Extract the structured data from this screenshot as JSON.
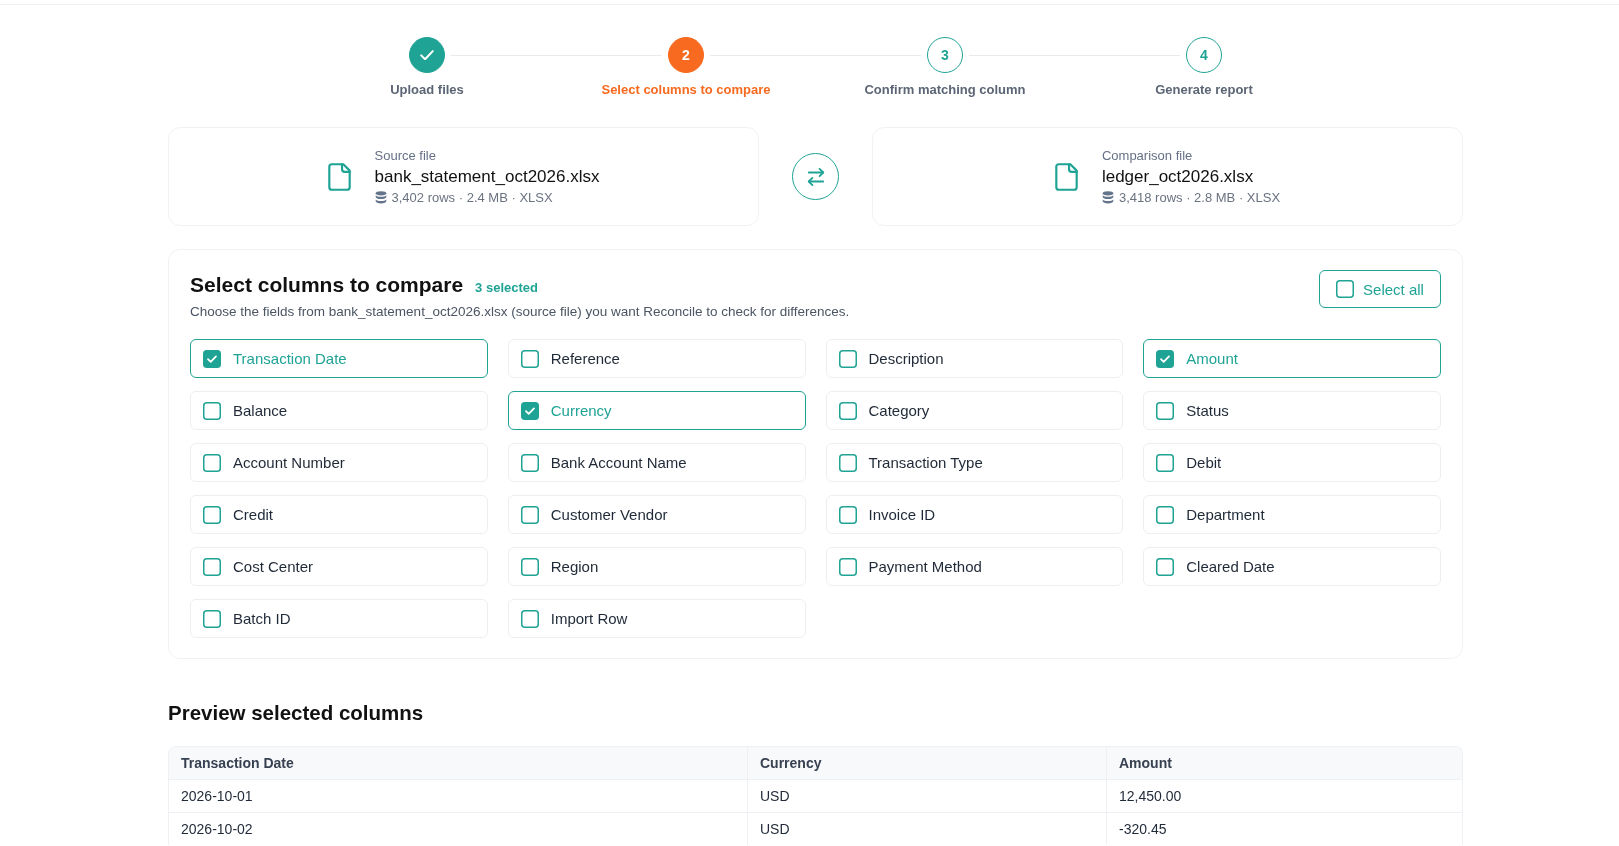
{
  "steps": [
    {
      "label": "Upload files",
      "done": true,
      "selected": false
    },
    {
      "number": "2",
      "label": "Select columns to compare",
      "done": false,
      "selected": true
    },
    {
      "number": "3",
      "label": "Confirm matching column",
      "done": false,
      "selected": false
    },
    {
      "number": "4",
      "label": "Generate report",
      "done": false,
      "selected": false
    }
  ],
  "files": [
    {
      "caption": "Source file",
      "name": "bank_statement_oct2026.xlsx",
      "meta": "3,402 rows · 2.4 MB · XLSX"
    },
    {
      "caption": "Comparison file",
      "name": "ledger_oct2026.xlsx",
      "meta": "3,418 rows · 2.8 MB · XLSX"
    }
  ],
  "column_picker": {
    "title": "Select columns to compare",
    "selected_count": "3 selected",
    "description": "Choose the fields from bank_statement_oct2026.xlsx (source file) you want Reconcile to check for differences.",
    "select_all": {
      "label": "Select all",
      "checked": false
    },
    "columns": [
      {
        "label": "Transaction Date",
        "checked": true
      },
      {
        "label": "Reference",
        "checked": false
      },
      {
        "label": "Description",
        "checked": false
      },
      {
        "label": "Amount",
        "checked": true
      },
      {
        "label": "Balance",
        "checked": false
      },
      {
        "label": "Currency",
        "checked": true
      },
      {
        "label": "Category",
        "checked": false
      },
      {
        "label": "Status",
        "checked": false
      },
      {
        "label": "Account Number",
        "checked": false
      },
      {
        "label": "Bank Account Name",
        "checked": false
      },
      {
        "label": "Transaction Type",
        "checked": false
      },
      {
        "label": "Debit",
        "checked": false
      },
      {
        "label": "Credit",
        "checked": false
      },
      {
        "label": "Customer Vendor",
        "checked": false
      },
      {
        "label": "Invoice ID",
        "checked": false
      },
      {
        "label": "Department",
        "checked": false
      },
      {
        "label": "Cost Center",
        "checked": false
      },
      {
        "label": "Region",
        "checked": false
      },
      {
        "label": "Payment Method",
        "checked": false
      },
      {
        "label": "Cleared Date",
        "checked": false
      },
      {
        "label": "Batch ID",
        "checked": false
      },
      {
        "label": "Import Row",
        "checked": false
      }
    ]
  },
  "preview": {
    "title": "Preview selected columns",
    "table": {
      "columns": [
        "Transaction Date",
        "Currency",
        "Amount"
      ],
      "rows": [
        [
          "2026-10-01",
          "USD",
          "12,450.00"
        ],
        [
          "2026-10-02",
          "USD",
          "-320.45"
        ]
      ]
    }
  }
}
